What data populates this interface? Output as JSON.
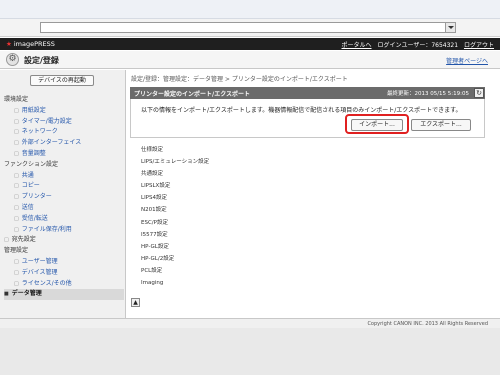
{
  "address": {
    "value": ""
  },
  "topbar": {
    "logo": "imagePRESS",
    "portal_link": "ポータルへ",
    "login_user": "ログインユーザー：7654321",
    "logout_link": "ログアウト"
  },
  "titlebar": {
    "title": "設定/登録",
    "admin_link": "管理者ページへ"
  },
  "sidebar": {
    "restart_button": "デバイスの再起動",
    "items": [
      {
        "label": "環境設定",
        "type": "heading"
      },
      {
        "label": "用紙設定",
        "type": "sub"
      },
      {
        "label": "タイマー/電力設定",
        "type": "sub"
      },
      {
        "label": "ネットワーク",
        "type": "sub"
      },
      {
        "label": "外部インターフェイス",
        "type": "sub"
      },
      {
        "label": "音量調整",
        "type": "sub"
      },
      {
        "label": "ファンクション設定",
        "type": "heading"
      },
      {
        "label": "共通",
        "type": "sub"
      },
      {
        "label": "コピー",
        "type": "sub"
      },
      {
        "label": "プリンター",
        "type": "sub"
      },
      {
        "label": "送信",
        "type": "sub"
      },
      {
        "label": "受信/転送",
        "type": "sub"
      },
      {
        "label": "ファイル保存/利用",
        "type": "sub"
      },
      {
        "label": "宛先設定",
        "type": "root-link"
      },
      {
        "label": "管理設定",
        "type": "heading"
      },
      {
        "label": "ユーザー管理",
        "type": "sub"
      },
      {
        "label": "デバイス管理",
        "type": "sub"
      },
      {
        "label": "ライセンス/その他",
        "type": "sub"
      },
      {
        "label": "データ管理",
        "type": "active"
      }
    ]
  },
  "content": {
    "breadcrumb": "設定/登録：管理設定：データ管理 > プリンター設定のインポート/エクスポート",
    "panel_title": "プリンター設定のインポート/エクスポート",
    "last_updated": "最終更新：2013 05/15 5:19:05",
    "description": "以下の情報をインポート/エクスポートします。機器情報配信で配信される項目のみインポート/エクスポートできます。",
    "import_button": "インポート...",
    "export_button": "エクスポート...",
    "settings": [
      "仕様設定",
      "LIPS/エミュレーション設定",
      "共通設定",
      "LIPSLX設定",
      "LIPS4設定",
      "N201設定",
      "ESC/P設定",
      "I5577設定",
      "HP-GL設定",
      "HP-GL/2設定",
      "PCL設定",
      "Imaging"
    ]
  },
  "footer": {
    "copyright": "Copyright CANON INC. 2013 All Rights Reserved"
  }
}
